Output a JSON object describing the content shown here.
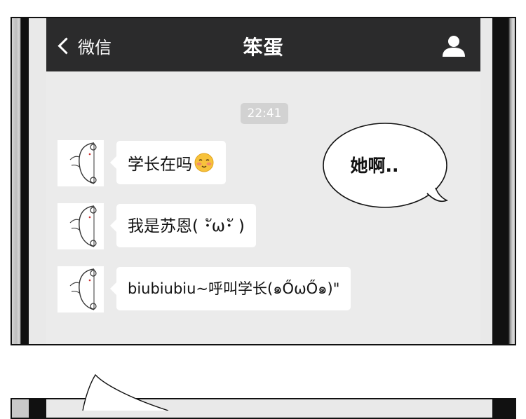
{
  "nav": {
    "back_label": "微信",
    "title": "笨蛋"
  },
  "chat": {
    "timestamp": "22:41",
    "messages": [
      {
        "text": "学长在吗",
        "emoji": "smiling-face-emoji"
      },
      {
        "text": "我是苏恩( ･ัω･ั )"
      },
      {
        "text": "biubiubiu~呼叫学长(๑ŐωŐ๑)\""
      }
    ]
  },
  "balloon": {
    "text": "她啊.."
  },
  "icons": [
    "chevron-left-icon",
    "person-icon",
    "smiling-face-emoji"
  ],
  "colors": {
    "navbar": "#2b2b2c",
    "chat_background": "#ebebeb",
    "bubble": "#ffffff",
    "timestamp_pill": "#d2d2d2"
  }
}
